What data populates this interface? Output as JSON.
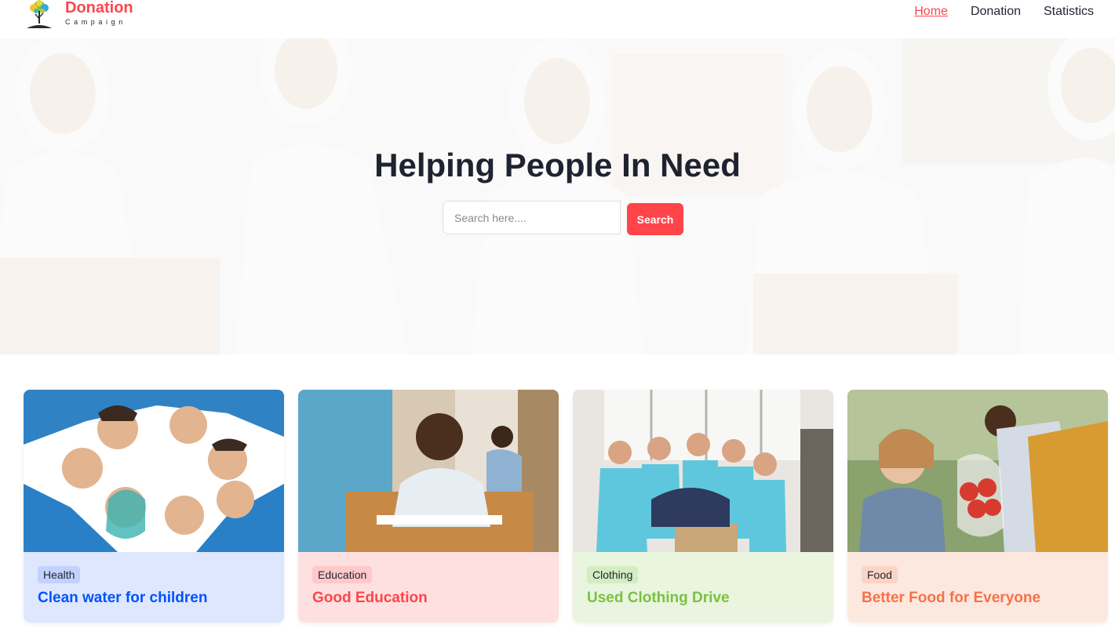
{
  "header": {
    "logo_title": "Donation",
    "logo_subtitle": "Campaign",
    "nav": [
      {
        "label": "Home",
        "active": true
      },
      {
        "label": "Donation",
        "active": false
      },
      {
        "label": "Statistics",
        "active": false
      }
    ]
  },
  "hero": {
    "title": "Helping People In Need",
    "search_placeholder": "Search here....",
    "search_value": "",
    "search_button": "Search"
  },
  "cards": [
    {
      "category": "Health",
      "title": "Clean water for children",
      "card_bg": "#dfe7ff",
      "badge_bg": "#c3d1fd",
      "text_color": "#0052ff"
    },
    {
      "category": "Education",
      "title": "Good Education",
      "card_bg": "#ffe0e1",
      "badge_bg": "#ffc8ca",
      "text_color": "#ff444a"
    },
    {
      "category": "Clothing",
      "title": "Used Clothing Drive",
      "card_bg": "#e9f5df",
      "badge_bg": "#d2edc2",
      "text_color": "#79c23f"
    },
    {
      "category": "Food",
      "title": "Better Food for Everyone",
      "card_bg": "#fde8e0",
      "badge_bg": "#fbd4c5",
      "text_color": "#f87147"
    }
  ],
  "colors": {
    "accent": "#ff444a",
    "text_dark": "#1f2330"
  },
  "icons": {
    "logo": "tree-logo-icon"
  }
}
